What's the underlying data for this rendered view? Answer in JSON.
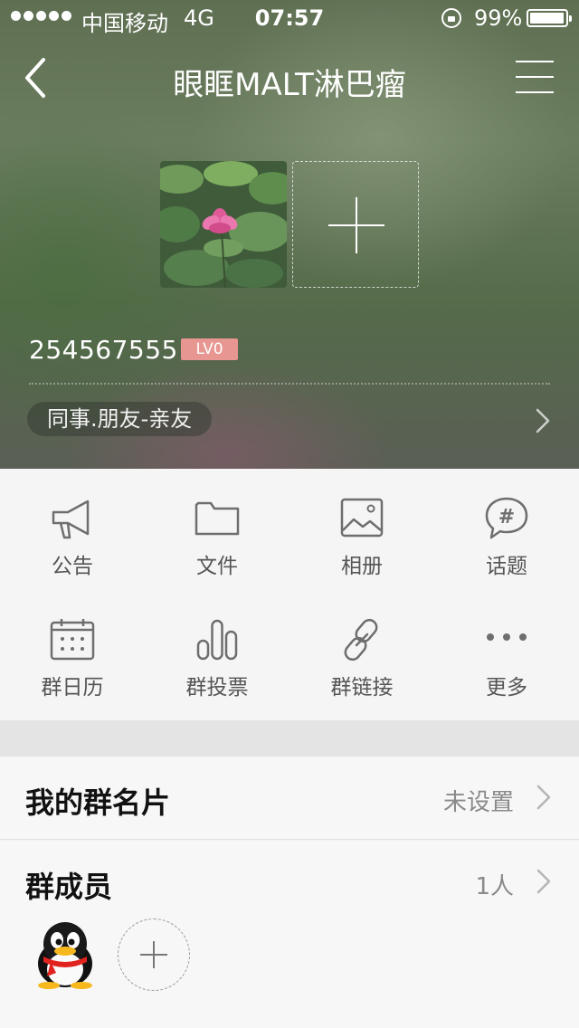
{
  "status_bar": {
    "carrier": "中国移动",
    "network": "4G",
    "time": "07:57",
    "battery": "99%"
  },
  "nav": {
    "title": "眼眶MALT淋巴瘤"
  },
  "group": {
    "id": "254567555",
    "level": "LV0",
    "category": "同事.朋友-亲友"
  },
  "features": [
    {
      "label": "公告",
      "icon": "megaphone-icon"
    },
    {
      "label": "文件",
      "icon": "folder-icon"
    },
    {
      "label": "相册",
      "icon": "photo-album-icon"
    },
    {
      "label": "话题",
      "icon": "topic-hashtag-icon"
    },
    {
      "label": "群日历",
      "icon": "calendar-icon"
    },
    {
      "label": "群投票",
      "icon": "bar-chart-icon"
    },
    {
      "label": "群链接",
      "icon": "link-icon"
    },
    {
      "label": "更多",
      "icon": "more-dots-icon"
    }
  ],
  "group_card": {
    "label": "我的群名片",
    "value": "未设置"
  },
  "members": {
    "label": "群成员",
    "count": "1人"
  },
  "colors": {
    "level_badge": "#e89691",
    "icon_gray": "#6e6e6e",
    "background": "#f5f5f5"
  }
}
